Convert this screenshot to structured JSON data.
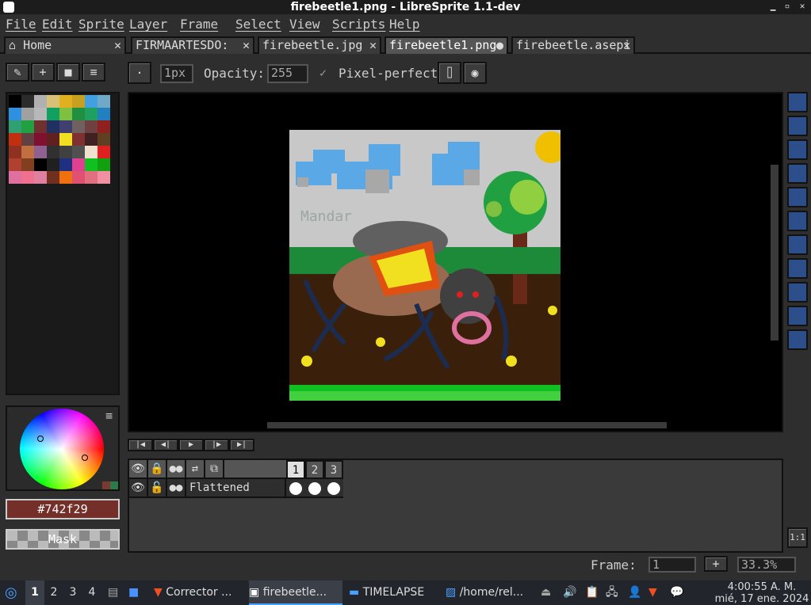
{
  "window": {
    "title": "firebeetle1.png - LibreSprite 1.1-dev"
  },
  "menu": [
    "File",
    "Edit",
    "Sprite",
    "Layer",
    "Frame",
    "Select",
    "View",
    "Scripts",
    "Help"
  ],
  "tabs": [
    {
      "label": "Home"
    },
    {
      "label": "FIRMAARTESDO:"
    },
    {
      "label": "firebeetle.jpg"
    },
    {
      "label": "firebeetle1.png"
    },
    {
      "label": "firebeetle.asepi"
    }
  ],
  "toolbar": {
    "brush_size": "1px",
    "opacity_label": "Opacity:",
    "opacity_value": "255",
    "pixel_perfect": "Pixel-perfect"
  },
  "canvas": {
    "watermark": "Mandar"
  },
  "color": {
    "current_hex": "#742f29",
    "mask_label": "Mask"
  },
  "timeline": {
    "frames": [
      "1",
      "2",
      "3"
    ],
    "layer_name": "Flattened",
    "frame_label": "Frame:",
    "frame_value": "1",
    "zoom": "33.3%",
    "one_to_one": "1:1"
  },
  "palette": [
    "#000000",
    "#2b2b2b",
    "#b0b0b0",
    "#d8c078",
    "#e0b020",
    "#c8a020",
    "#40a0e0",
    "#70a8c8",
    "#3090e0",
    "#a0a0a0",
    "#b8b8b8",
    "#10a060",
    "#80c040",
    "#209040",
    "#20a060",
    "#2080c0",
    "#30a070",
    "#20a040",
    "#703030",
    "#203060",
    "#404070",
    "#706060",
    "#704040",
    "#902020",
    "#c03010",
    "#604040",
    "#801030",
    "#602020",
    "#f0e020",
    "#803030",
    "#402020",
    "#604020",
    "#903020",
    "#c07040",
    "#906090",
    "#303030",
    "#404040",
    "#505050",
    "#f0e0d0",
    "#e02020",
    "#b04030",
    "#804020",
    "#000000",
    "#202020",
    "#203080",
    "#e04090",
    "#10c020",
    "#10a010",
    "#e070a0",
    "#f07090",
    "#e080a0",
    "#703020",
    "#f07010",
    "#e05070",
    "#e07080",
    "#f090a0"
  ],
  "taskbar": {
    "workspaces": [
      "1",
      "2",
      "3",
      "4"
    ],
    "apps": [
      "Corrector ...",
      "firebeetle...",
      "TIMELAPSE",
      "/home/rel..."
    ],
    "clock_time": "4:00:55 A. M.",
    "clock_date": "mié, 17 ene. 2024"
  }
}
